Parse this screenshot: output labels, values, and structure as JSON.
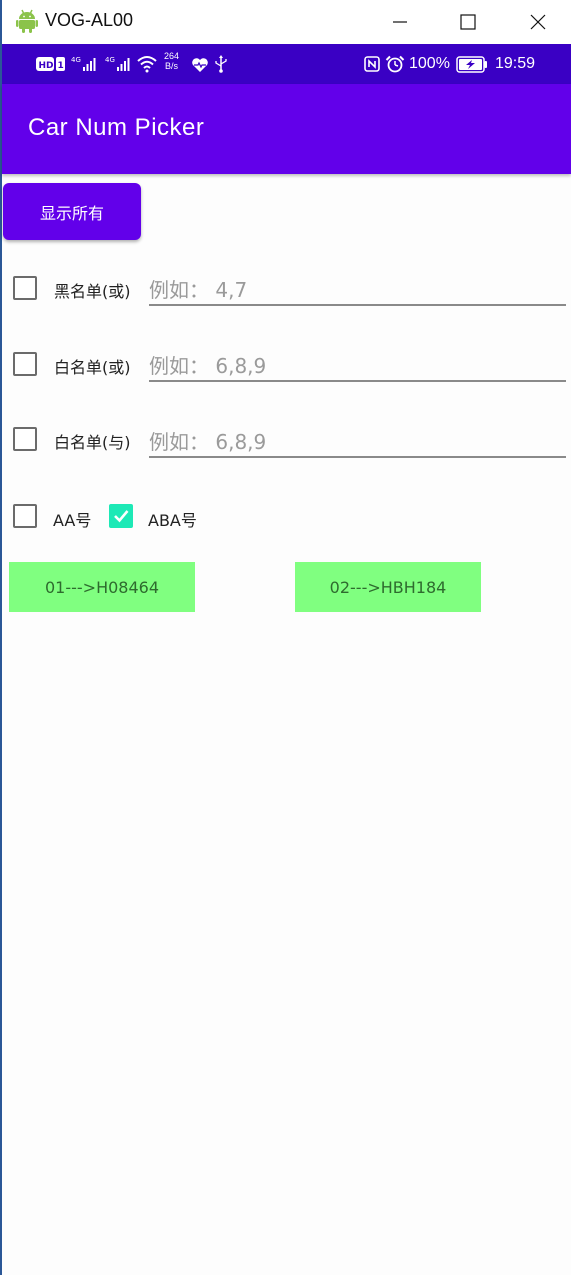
{
  "window": {
    "title": "VOG-AL00",
    "minimize_icon": "minimize-icon",
    "maximize_icon": "maximize-icon",
    "close_icon": "close-icon"
  },
  "status_bar": {
    "speed_value": "264",
    "speed_unit": "B/s",
    "battery": "100%",
    "time": "19:59"
  },
  "app_bar": {
    "title": "Car Num Picker"
  },
  "main": {
    "show_all_label": "显示所有",
    "filters": [
      {
        "label": "黑名单(或)",
        "placeholder": "例如：  4,7",
        "checked": false
      },
      {
        "label": "白名单(或)",
        "placeholder": "例如：  6,8,9",
        "checked": false
      },
      {
        "label": "白名单(与)",
        "placeholder": "例如：  6,8,9",
        "checked": false
      }
    ],
    "options": [
      {
        "label": "AA号",
        "checked": false
      },
      {
        "label": "ABA号",
        "checked": true
      }
    ],
    "results": [
      "01--->H08464",
      "02--->HBH184"
    ]
  },
  "colors": {
    "status_bar": "#3a00c4",
    "app_bar": "#6200ea",
    "primary_button": "#6200ea",
    "checkbox_checked": "#1de9b6",
    "result_button": "#80ff80"
  }
}
